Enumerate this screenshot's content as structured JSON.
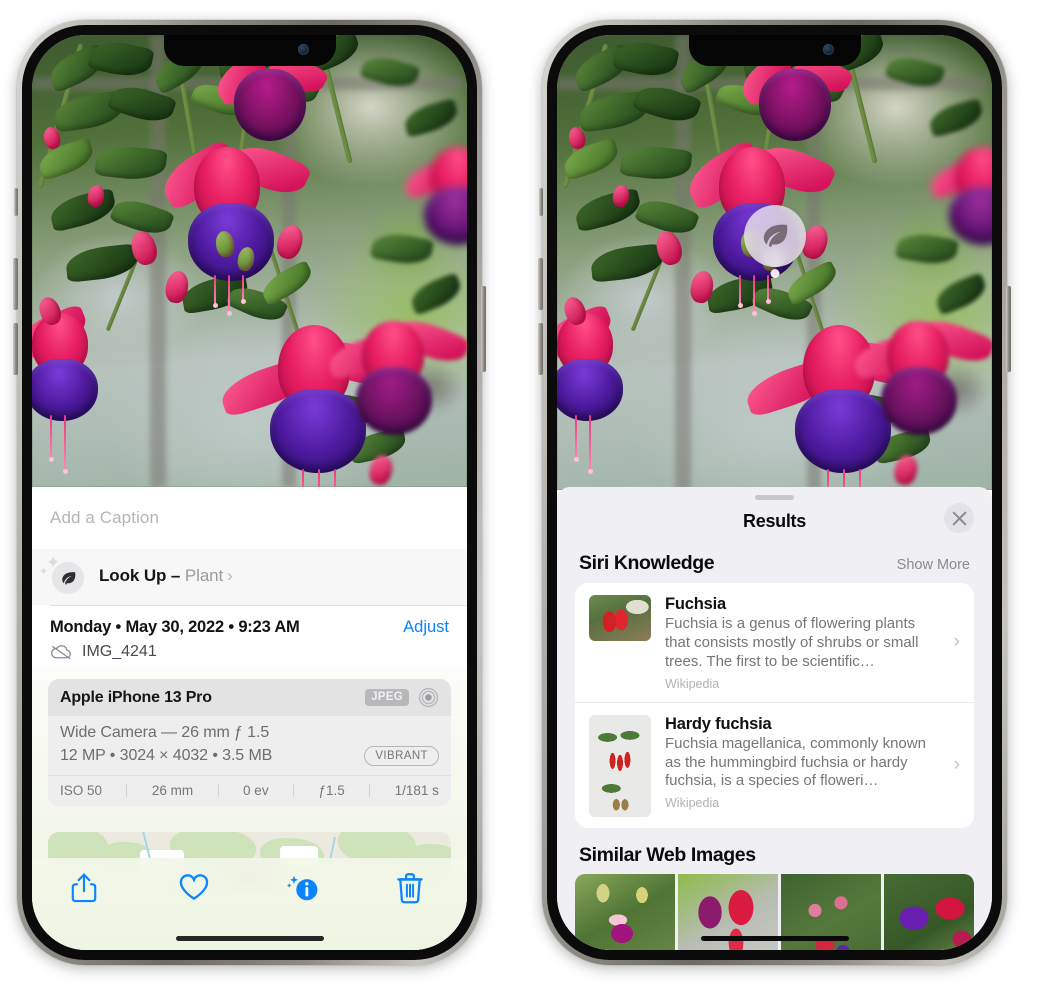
{
  "left_phone": {
    "name": "photos-info-screen",
    "caption": {
      "placeholder": "Add a Caption",
      "value": ""
    },
    "lookup": {
      "icon": "leaf-icon",
      "label": "Look Up",
      "dash": " – ",
      "subject": "Plant",
      "chevron": "›"
    },
    "meta": {
      "date": "Monday • May 30, 2022 • 9:23 AM",
      "adjust_label": "Adjust",
      "filename": "IMG_4241",
      "cloud_icon": "cloud-slash-icon"
    },
    "camera": {
      "model": "Apple iPhone 13 Pro",
      "format_tag": "JPEG",
      "hdr_icon": "hdr-circle-icon",
      "lens": "Wide Camera — 26 mm ƒ 1.5",
      "specs": "12 MP • 3024 × 4032 • 3.5 MB",
      "style_tag": "VIBRANT",
      "exif": [
        "ISO 50",
        "26 mm",
        "0 ev",
        "ƒ1.5",
        "1/181 s"
      ]
    },
    "map": {
      "name": "location-map-card",
      "pin": "photo-thumbnail-pin"
    },
    "toolbar": [
      {
        "name": "share-button",
        "icon": "share-icon"
      },
      {
        "name": "favorite-button",
        "icon": "heart-icon"
      },
      {
        "name": "info-button",
        "icon": "info-sparkle-icon"
      },
      {
        "name": "delete-button",
        "icon": "trash-icon"
      }
    ],
    "accent_color": "#0a84ff"
  },
  "right_phone": {
    "name": "visual-lookup-results-screen",
    "badge": {
      "icon": "leaf-icon",
      "name": "visual-lookup-badge"
    },
    "sheet": {
      "title": "Results",
      "close_icon": "close-x-icon",
      "grabber": "sheet-grabber"
    },
    "siri_knowledge": {
      "heading": "Siri Knowledge",
      "show_more": "Show More",
      "items": [
        {
          "title": "Fuchsia",
          "description": "Fuchsia is a genus of flowering plants that consists mostly of shrubs or small trees. The first to be scientific…",
          "source": "Wikipedia",
          "thumb": "fuchsia-red-flowers-thumbnail"
        },
        {
          "title": "Hardy fuchsia",
          "description": "Fuchsia magellanica, commonly known as the hummingbird fuchsia or hardy fuchsia, is a species of floweri…",
          "source": "Wikipedia",
          "thumb": "hardy-fuchsia-specimen-thumbnail"
        }
      ]
    },
    "similar_web_images": {
      "heading": "Similar Web Images",
      "items": [
        {
          "name": "web-image-1",
          "alt": "pink and magenta fuchsia with green leaves"
        },
        {
          "name": "web-image-2",
          "alt": "red and purple fuchsia close-up"
        },
        {
          "name": "web-image-3",
          "alt": "fuchsia bush with many buds"
        },
        {
          "name": "web-image-4",
          "alt": "purple and red double fuchsia blooms"
        }
      ]
    }
  }
}
